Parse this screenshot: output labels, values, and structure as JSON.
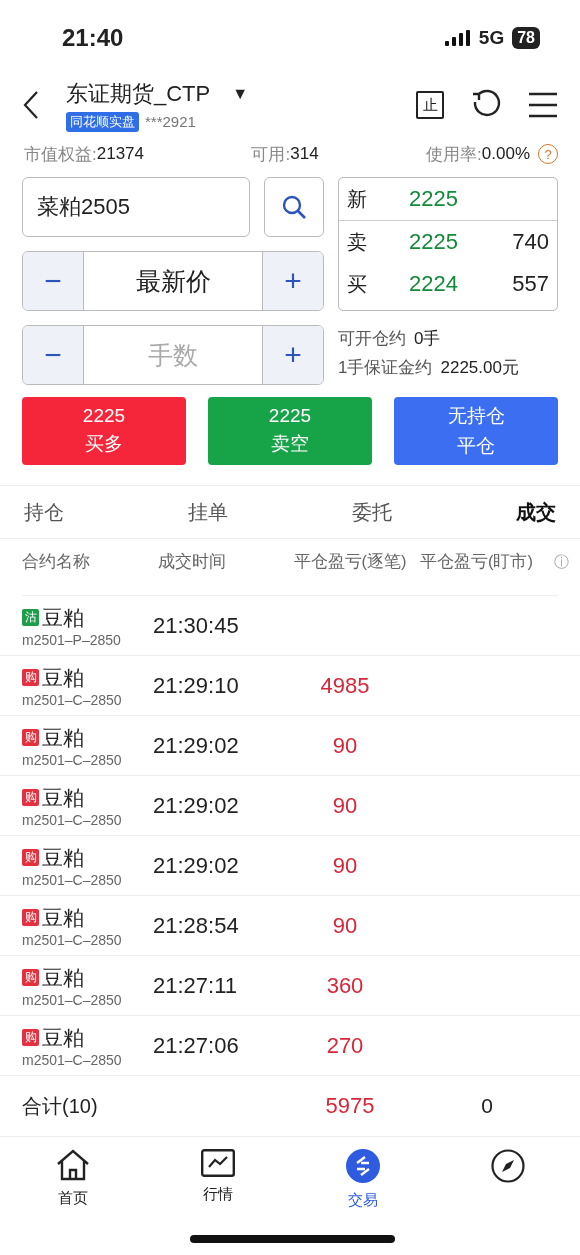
{
  "status_bar": {
    "time": "21:40",
    "network": "5G",
    "battery": "78"
  },
  "header": {
    "account": "东证期货_CTP",
    "dropdown": "▼",
    "badge": "同花顺实盘",
    "account_no": "***2921",
    "stop_icon": "止"
  },
  "summary": [
    {
      "label": "市值权益:",
      "value": "21374"
    },
    {
      "label": "可用:",
      "value": "314"
    },
    {
      "label": "使用率:",
      "value": "0.00%",
      "help": "?"
    }
  ],
  "order": {
    "symbol": "菜粕2505",
    "price_minus": "−",
    "price": "最新价",
    "price_plus": "+",
    "qty_minus": "−",
    "qty_placeholder": "手数",
    "qty_plus": "+"
  },
  "quote": [
    {
      "label": "新",
      "price": "2225"
    },
    {
      "label": "卖",
      "price": "2225",
      "volume": "740"
    },
    {
      "label": "买",
      "price": "2224",
      "volume": "557"
    }
  ],
  "capacity": [
    {
      "label": "可开仓约",
      "value": "0手"
    },
    {
      "label": "1手保证金约",
      "value": "2225.00元"
    }
  ],
  "actions": [
    {
      "line1": "2225",
      "line2": "买多",
      "color": "#f5253a"
    },
    {
      "line1": "2225",
      "line2": "卖空",
      "color": "#17a348"
    },
    {
      "line1": "无持仓",
      "line2": "平仓",
      "color": "#3c6ef2"
    }
  ],
  "tabs": [
    {
      "label": "持仓",
      "selected": false
    },
    {
      "label": "挂单",
      "selected": false
    },
    {
      "label": "委托",
      "selected": false
    },
    {
      "label": "成交",
      "selected": true
    }
  ],
  "table": {
    "columns": [
      "合约名称",
      "成交时间",
      "平仓盈亏(逐笔)",
      "平仓盈亏(盯市)"
    ],
    "info_icon": "ⓘ",
    "rows": [
      {
        "tag": "沽",
        "color": "#1e9e4a",
        "name": "豆粕",
        "code": "m2501–P–2850",
        "time": "21:30:45"
      },
      {
        "tag": "购",
        "color": "#e5303f",
        "name": "豆粕",
        "code": "m2501–C–2850",
        "time": "21:29:10",
        "pnl": "4985"
      },
      {
        "tag": "购",
        "color": "#e5303f",
        "name": "豆粕",
        "code": "m2501–C–2850",
        "time": "21:29:02",
        "pnl": "90"
      },
      {
        "tag": "购",
        "color": "#e5303f",
        "name": "豆粕",
        "code": "m2501–C–2850",
        "time": "21:29:02",
        "pnl": "90"
      },
      {
        "tag": "购",
        "color": "#e5303f",
        "name": "豆粕",
        "code": "m2501–C–2850",
        "time": "21:29:02",
        "pnl": "90"
      },
      {
        "tag": "购",
        "color": "#e5303f",
        "name": "豆粕",
        "code": "m2501–C–2850",
        "time": "21:28:54",
        "pnl": "90"
      },
      {
        "tag": "购",
        "color": "#e5303f",
        "name": "豆粕",
        "code": "m2501–C–2850",
        "time": "21:27:11",
        "pnl": "360"
      },
      {
        "tag": "购",
        "color": "#e5303f",
        "name": "豆粕",
        "code": "m2501–C–2850",
        "time": "21:27:06",
        "pnl": "270"
      }
    ],
    "total": {
      "label": "合计(10)",
      "pnl": "5975",
      "pnl_market": "0"
    }
  },
  "nav": [
    {
      "kind": "home",
      "label": "首页",
      "selected": false
    },
    {
      "kind": "chart",
      "label": "行情",
      "selected": false
    },
    {
      "kind": "trade",
      "label": "交易",
      "selected": true
    },
    {
      "kind": "compass",
      "selected": false
    }
  ]
}
